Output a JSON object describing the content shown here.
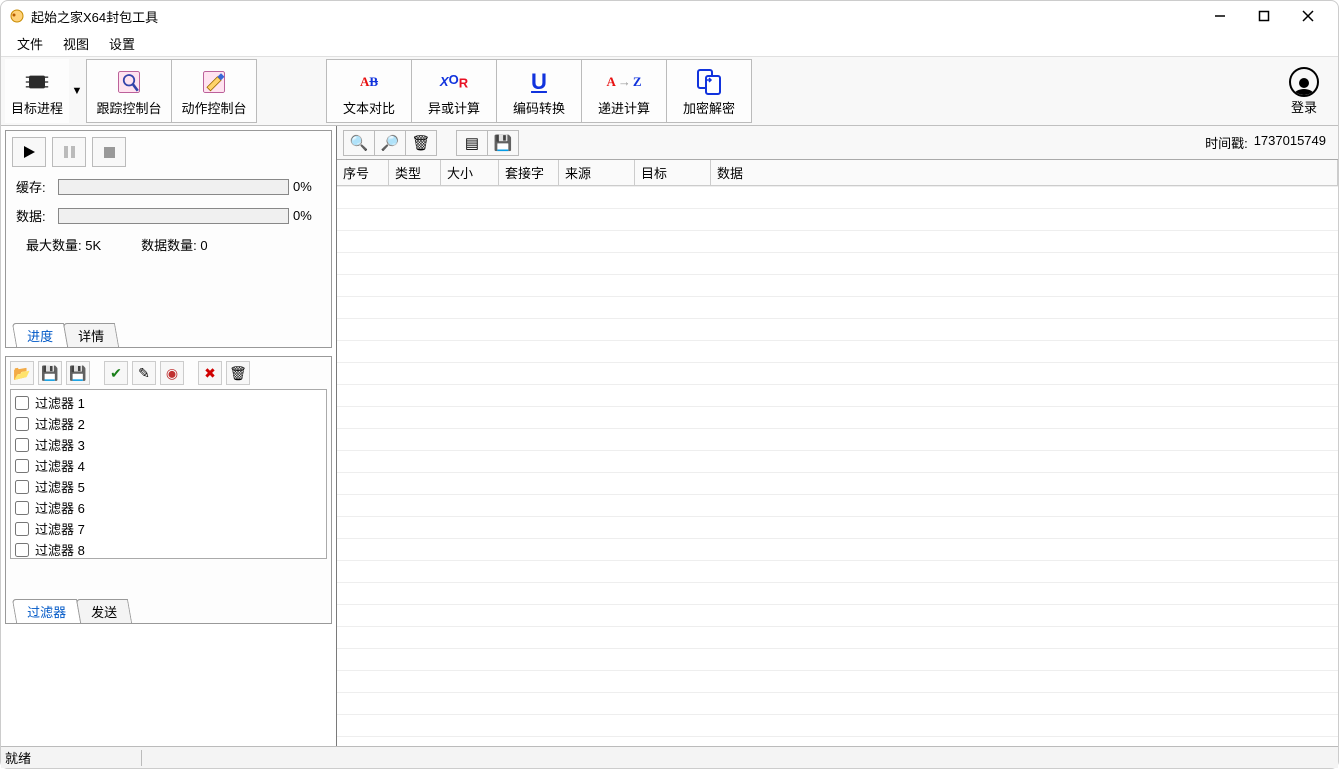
{
  "window": {
    "title": "起始之家X64封包工具"
  },
  "menubar": {
    "file": "文件",
    "view": "视图",
    "settings": "设置"
  },
  "toolbar": {
    "target_process": "目标进程",
    "trace_console": "跟踪控制台",
    "action_console": "动作控制台",
    "text_compare": "文本对比",
    "text_compare_icon": "AB",
    "xor_calc": "异或计算",
    "encode_convert": "编码转换",
    "radix_calc": "递进计算",
    "radix_calc_icon": "AZ",
    "crypto": "加密解密",
    "login": "登录"
  },
  "progress": {
    "cache_label": "缓存:",
    "cache_pct": "0%",
    "data_label": "数据:",
    "data_pct": "0%",
    "max_count": "最大数量: 5K",
    "data_count": "数据数量: 0",
    "tab_progress": "进度",
    "tab_details": "详情"
  },
  "filters": {
    "tab_filter": "过滤器",
    "tab_send": "发送",
    "items": [
      "过滤器 1",
      "过滤器 2",
      "过滤器 3",
      "过滤器 4",
      "过滤器 5",
      "过滤器 6",
      "过滤器 7",
      "过滤器 8"
    ]
  },
  "subtoolbar": {
    "timestamp_label": "时间戳:",
    "timestamp": "1737015749"
  },
  "grid": {
    "columns": [
      "序号",
      "类型",
      "大小",
      "套接字",
      "来源",
      "目标",
      "数据"
    ]
  },
  "status": {
    "ready": "就绪"
  }
}
